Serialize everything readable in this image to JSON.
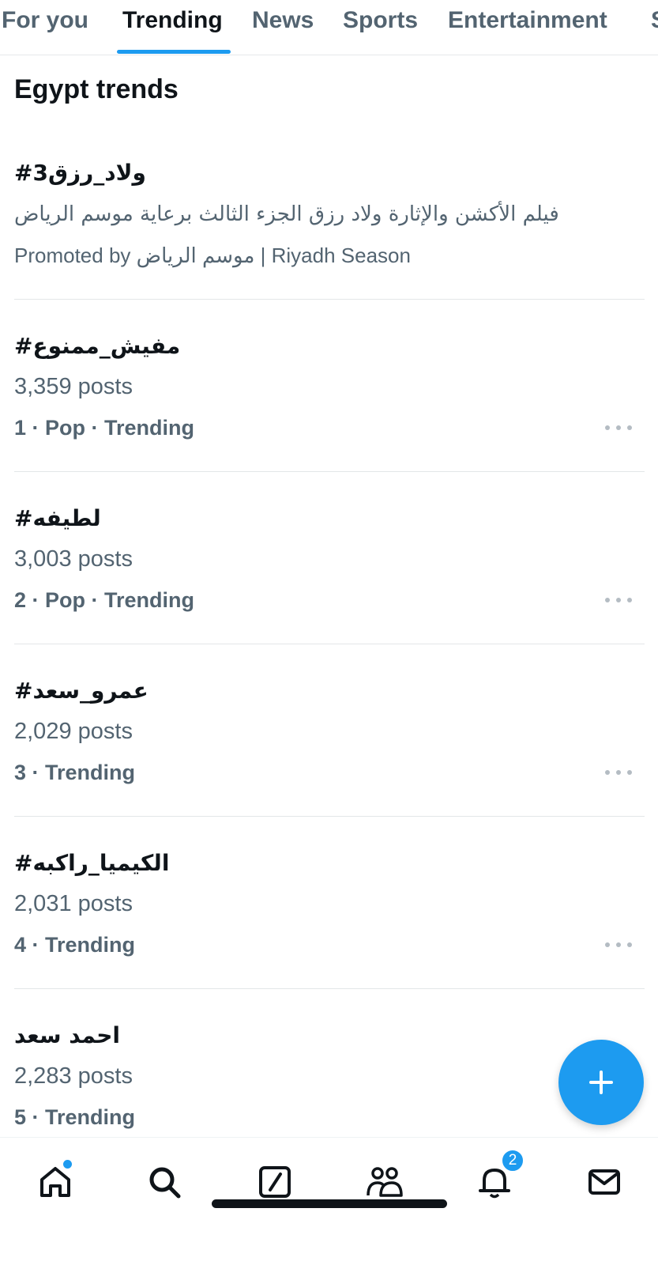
{
  "tabs": [
    {
      "label": "For you",
      "active": false
    },
    {
      "label": "Trending",
      "active": true
    },
    {
      "label": "News",
      "active": false
    },
    {
      "label": "Sports",
      "active": false
    },
    {
      "label": "Entertainment",
      "active": false
    },
    {
      "label": "S",
      "active": false
    }
  ],
  "section_title": "Egypt trends",
  "promoted": {
    "name": "#ولاد_رزق3",
    "description": "فيلم الأكشن والإثارة ولاد رزق الجزء الثالث برعاية موسم الرياض",
    "promoted_by": "Promoted by موسم الرياض | Riyadh Season"
  },
  "trends": [
    {
      "name": "#مفيش_ممنوع",
      "posts": "3,359 posts",
      "meta": "1 · Pop · Trending"
    },
    {
      "name": "#لطيفه",
      "posts": "3,003 posts",
      "meta": "2 · Pop · Trending"
    },
    {
      "name": "#عمرو_سعد",
      "posts": "2,029 posts",
      "meta": "3 · Trending"
    },
    {
      "name": "#الكيميا_راكبه",
      "posts": "2,031 posts",
      "meta": "4 · Trending"
    },
    {
      "name": "احمد سعد",
      "posts": "2,283 posts",
      "meta": "5 · Trending"
    }
  ],
  "fab": {
    "icon": "plus-icon"
  },
  "bottom_nav": [
    {
      "icon": "home-icon",
      "has_dot": true
    },
    {
      "icon": "search-icon"
    },
    {
      "icon": "grok-icon"
    },
    {
      "icon": "communities-icon"
    },
    {
      "icon": "bell-icon",
      "badge": "2"
    },
    {
      "icon": "mail-icon"
    }
  ],
  "colors": {
    "accent": "#1d9bf0",
    "text_primary": "#0f1419",
    "text_secondary": "#536471"
  }
}
